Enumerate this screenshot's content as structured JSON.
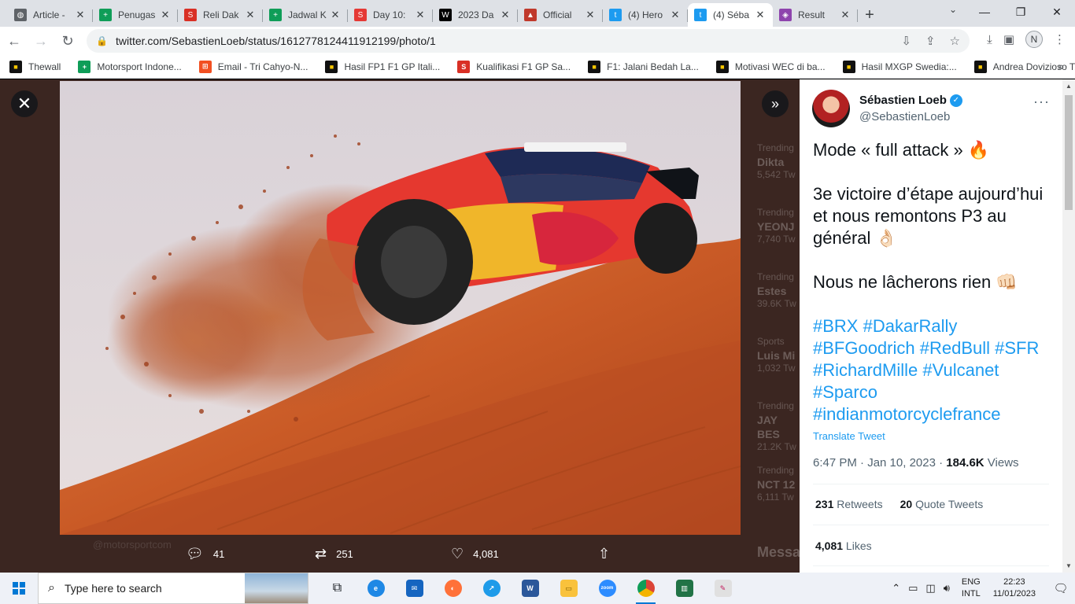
{
  "browser": {
    "tabs": [
      {
        "title": "Article -",
        "fav_color": "#5f6368",
        "fav_glyph": "◍"
      },
      {
        "title": "Penugas",
        "fav_color": "#0f9d58",
        "fav_glyph": "+"
      },
      {
        "title": "Reli Dak",
        "fav_color": "#d93025",
        "fav_glyph": "S"
      },
      {
        "title": "Jadwal K",
        "fav_color": "#0f9d58",
        "fav_glyph": "+"
      },
      {
        "title": "Day 10:",
        "fav_color": "#e53935",
        "fav_glyph": "S"
      },
      {
        "title": "2023 Da",
        "fav_color": "#000000",
        "fav_glyph": "W"
      },
      {
        "title": "Official",
        "fav_color": "#c0392b",
        "fav_glyph": "▲"
      },
      {
        "title": "(4) Hero",
        "fav_color": "#1d9bf0",
        "fav_glyph": "t"
      },
      {
        "title": "(4) Séba",
        "fav_color": "#1d9bf0",
        "fav_glyph": "t"
      },
      {
        "title": "Result",
        "fav_color": "#8e44ad",
        "fav_glyph": "◈"
      }
    ],
    "url": "twitter.com/SebastienLoeb/status/1612778124411912199/photo/1",
    "profile_initial": "N",
    "bookmarks": [
      {
        "label": "Thewall",
        "color": "#f9c700",
        "glyph": "■"
      },
      {
        "label": "Motorsport Indone...",
        "color": "#0f9d58",
        "glyph": "+"
      },
      {
        "label": "Email - Tri Cahyo-N...",
        "color": "#f25022",
        "glyph": "⊞"
      },
      {
        "label": "Hasil FP1 F1 GP Itali...",
        "color": "#f9c700",
        "glyph": "■"
      },
      {
        "label": "Kualifikasi F1 GP Sa...",
        "color": "#d93025",
        "glyph": "S"
      },
      {
        "label": "F1: Jalani Bedah La...",
        "color": "#f9c700",
        "glyph": "■"
      },
      {
        "label": "Motivasi WEC di ba...",
        "color": "#f9c700",
        "glyph": "■"
      },
      {
        "label": "Hasil MXGP Swedia:...",
        "color": "#f9c700",
        "glyph": "■"
      },
      {
        "label": "Andrea Dovizioso T...",
        "color": "#f9c700",
        "glyph": "■"
      }
    ]
  },
  "photo_actions": {
    "replies": "41",
    "retweets": "251",
    "likes": "4,081"
  },
  "tweet": {
    "display_name": "Sébastien Loeb",
    "handle": "@SebastienLoeb",
    "line1": "Mode « full attack » 🔥",
    "line2": "3e victoire d’étape aujourd’hui et nous remontons P3 au général 👌🏻",
    "line3": "Nous ne lâcherons rien 👊🏻",
    "hashtags": "#BRX #DakarRally #BFGoodrich #RedBull #SFR #RichardMille #Vulcanet #Sparco #indianmotorcyclefrance",
    "translate": "Translate Tweet",
    "time": "6:47 PM · Jan 10, 2023 · ",
    "views_count": "184.6K",
    "views_label": " Views",
    "retweets_count": "231",
    "retweets_label": " Retweets",
    "quotes_count": "20",
    "quotes_label": " Quote Tweets",
    "likes_count": "4,081",
    "likes_label": " Likes"
  },
  "background_trends": [
    {
      "cat": "Trending",
      "name": "Dikta",
      "count": "5,542 Tw"
    },
    {
      "cat": "Trending",
      "name": "YEONJ",
      "count": "7,740 Tw"
    },
    {
      "cat": "Trending",
      "name": "Estes",
      "count": "39.6K Tw"
    },
    {
      "cat": "Sports",
      "name": "Luis Mi",
      "count": "1,032 Tw"
    },
    {
      "cat": "Trending",
      "name": "JAY BES",
      "count": "21.2K Tw"
    },
    {
      "cat": "Trending",
      "name": "NCT 12",
      "count": "6,111 Tw"
    }
  ],
  "background_messages": "Messa",
  "background_handle": "@motorsportcom",
  "taskbar": {
    "search_placeholder": "Type here to search",
    "lang1": "ENG",
    "lang2": "INTL",
    "time": "22:23",
    "date": "11/01/2023"
  }
}
